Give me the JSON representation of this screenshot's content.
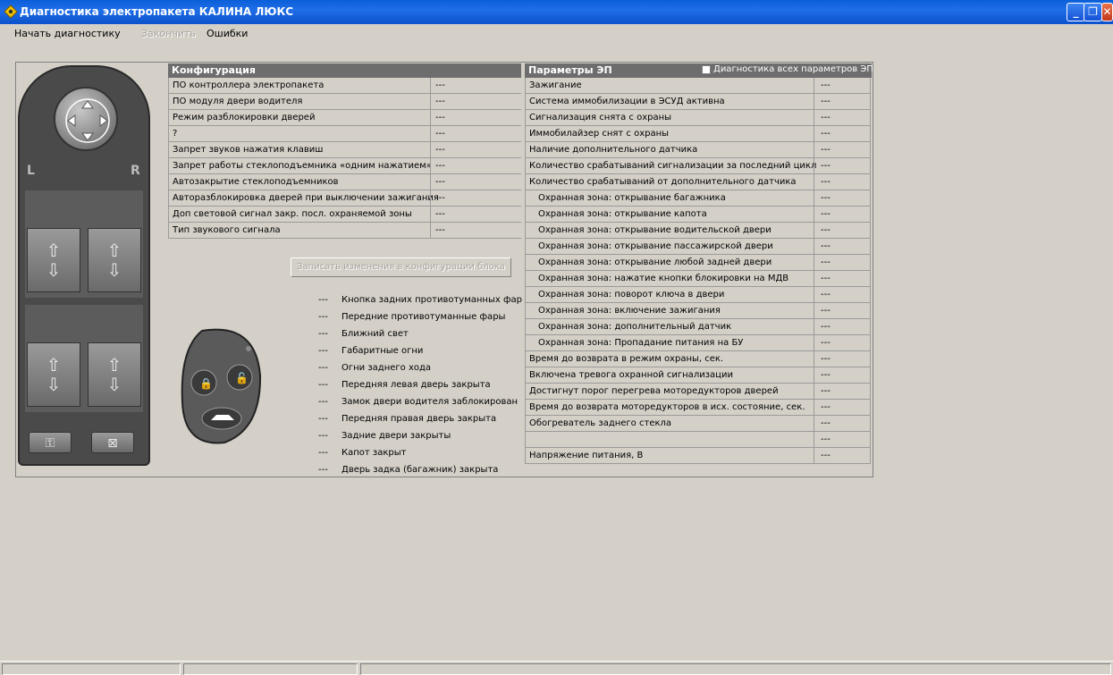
{
  "window": {
    "title": "Диагностика электропакета КАЛИНА ЛЮКС",
    "icon": "diamond-app-icon",
    "title_bar_color": "#0a5fd8"
  },
  "menu": {
    "start": "Начать диагностику",
    "finish": "Закончить",
    "errors": "Ошибки"
  },
  "config": {
    "header": "Конфигурация",
    "rows": [
      {
        "label": "ПО контроллера электропакета",
        "value": "---"
      },
      {
        "label": "ПО модуля двери водителя",
        "value": "---"
      },
      {
        "label": "Режим разблокировки дверей",
        "value": "---"
      },
      {
        "label": "?",
        "value": "---"
      },
      {
        "label": "Запрет звуков нажатия клавиш",
        "value": "---"
      },
      {
        "label": "Запрет работы стеклоподъемника «одним нажатием»",
        "value": "---"
      },
      {
        "label": "Автозакрытие стеклоподъемников",
        "value": "---"
      },
      {
        "label": "Авторазблокировка дверей при выключении зажигания",
        "value": "---"
      },
      {
        "label": "Доп световой сигнал закр. посл. охраняемой зоны",
        "value": "---"
      },
      {
        "label": "Тип звукового сигнала",
        "value": "---"
      }
    ],
    "write_button": "Записать изменения в конфигурации блока"
  },
  "status": {
    "items": [
      {
        "value": "---",
        "label": "Кнопка задних противотуманных фар"
      },
      {
        "value": "---",
        "label": "Передние противотуманные фары"
      },
      {
        "value": "---",
        "label": "Ближний свет"
      },
      {
        "value": "---",
        "label": "Габаритные огни"
      },
      {
        "value": "---",
        "label": "Огни заднего хода"
      },
      {
        "value": "---",
        "label": "Передняя левая дверь закрыта"
      },
      {
        "value": "---",
        "label": "Замок двери водителя заблокирован"
      },
      {
        "value": "---",
        "label": "Передняя правая дверь закрыта"
      },
      {
        "value": "---",
        "label": "Задние двери закрыты"
      },
      {
        "value": "---",
        "label": "Капот закрыт"
      },
      {
        "value": "---",
        "label": "Дверь задка (багажник) закрыта"
      }
    ]
  },
  "params": {
    "header": "Параметры ЭП",
    "all_params_label": "Диагностика всех параметров ЭП",
    "rows": [
      {
        "label": "Зажигание",
        "value": "---",
        "indent": false
      },
      {
        "label": "Система иммобилизации в ЭСУД активна",
        "value": "---",
        "indent": false
      },
      {
        "label": "Сигнализация снята с охраны",
        "value": "---",
        "indent": false
      },
      {
        "label": "Иммобилайзер снят с охраны",
        "value": "---",
        "indent": false
      },
      {
        "label": "Наличие дополнительного датчика",
        "value": "---",
        "indent": false
      },
      {
        "label": "Количество срабатываний сигнализации за последний цикл",
        "value": "---",
        "indent": false
      },
      {
        "label": "Количество срабатываний от дополнительного датчика",
        "value": "---",
        "indent": false
      },
      {
        "label": "Охранная зона: открывание багажника",
        "value": "---",
        "indent": true
      },
      {
        "label": "Охранная зона: открывание капота",
        "value": "---",
        "indent": true
      },
      {
        "label": "Охранная зона: открывание водительской двери",
        "value": "---",
        "indent": true
      },
      {
        "label": "Охранная зона: открывание пассажирской двери",
        "value": "---",
        "indent": true
      },
      {
        "label": "Охранная зона: открывание любой задней двери",
        "value": "---",
        "indent": true
      },
      {
        "label": "Охранная зона: нажатие кнопки блокировки на МДВ",
        "value": "---",
        "indent": true
      },
      {
        "label": "Охранная зона: поворот ключа в двери",
        "value": "---",
        "indent": true
      },
      {
        "label": "Охранная зона: включение зажигания",
        "value": "---",
        "indent": true
      },
      {
        "label": "Охранная зона: дополнительный датчик",
        "value": "---",
        "indent": true
      },
      {
        "label": "Охранная зона: Пропадание питания на БУ",
        "value": "---",
        "indent": true
      },
      {
        "label": "Время до возврата в режим охраны, сек.",
        "value": "---",
        "indent": false
      },
      {
        "label": "Включена тревога охранной сигнализации",
        "value": "---",
        "indent": false
      },
      {
        "label": "Достигнут порог перегрева моторедукторов дверей",
        "value": "---",
        "indent": false
      },
      {
        "label": "Время до возврата моторедукторов в исх. состояние, сек.",
        "value": "---",
        "indent": false
      },
      {
        "label": "Обогреватель заднего стекла",
        "value": "---",
        "indent": false
      },
      {
        "label": "",
        "value": "---",
        "indent": false
      },
      {
        "label": "Напряжение питания, В",
        "value": "---",
        "indent": false
      }
    ]
  },
  "console": {
    "left_label": "L",
    "right_label": "R",
    "key_icon": "key-icon",
    "lock_icon": "lock-icon"
  }
}
